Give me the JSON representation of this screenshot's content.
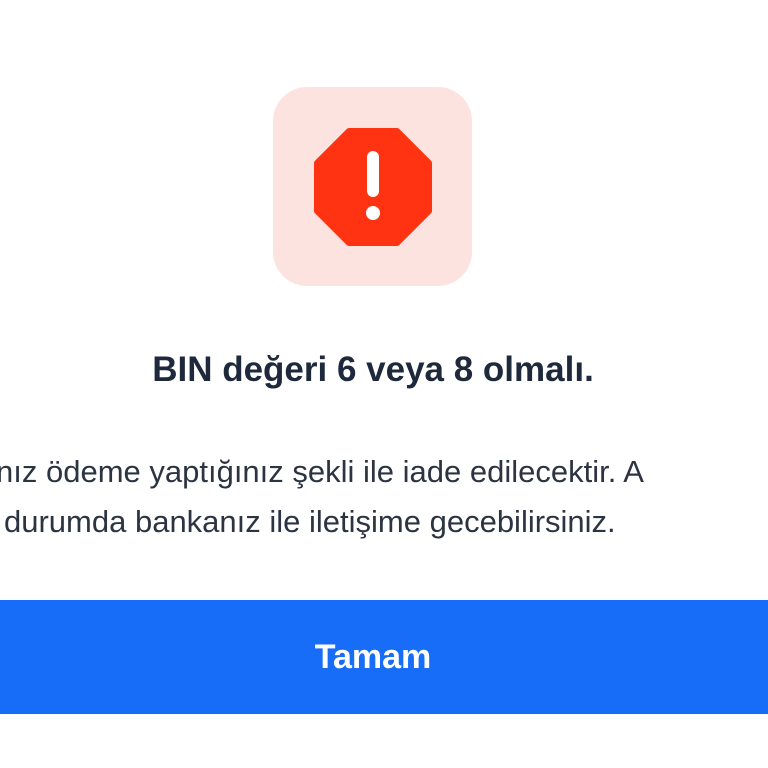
{
  "dialog": {
    "icon": "alert-octagon-icon",
    "title": "BIN değeri 6 veya 8 olmalı.",
    "message_lines": [
      "nız ödeme yaptığınız şekli ile iade edilecektir. A",
      "durumda bankanız ile iletişime gecebilirsiniz."
    ],
    "confirm_label": "Tamam"
  },
  "colors": {
    "icon_tile_bg": "#fde3df",
    "alert_red": "#ff3311",
    "button_blue": "#176df8",
    "title_text": "#1e2a3b"
  }
}
